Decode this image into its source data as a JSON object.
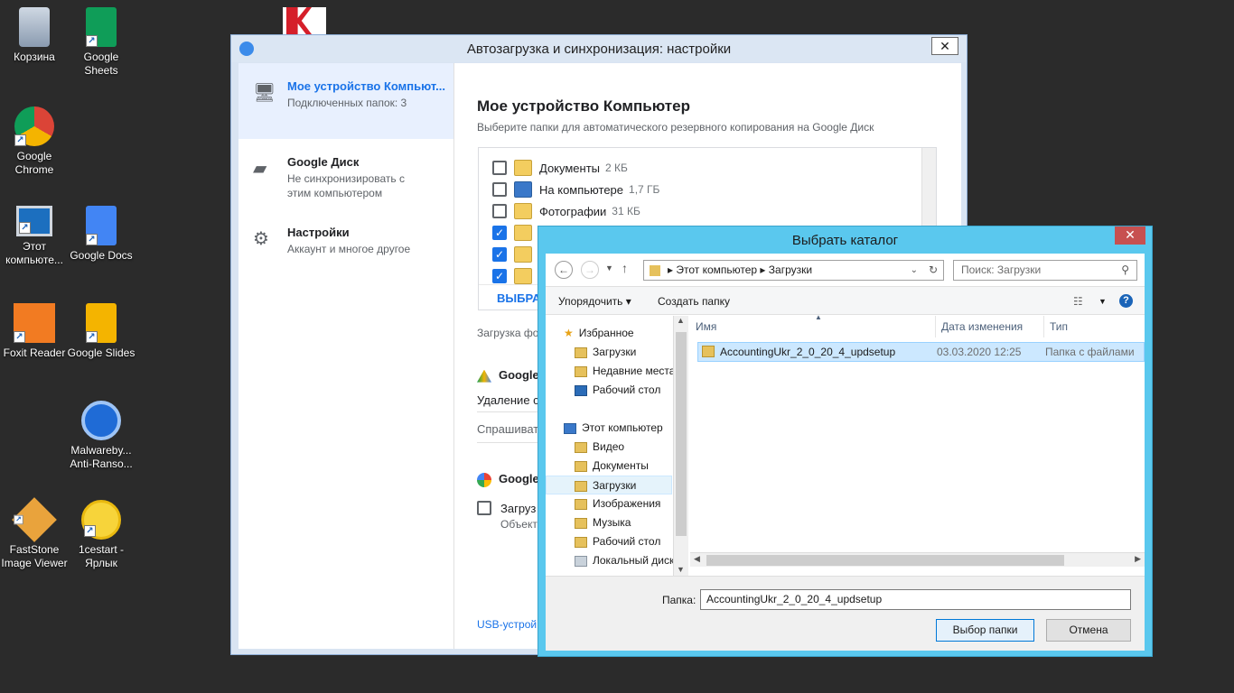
{
  "desktop": {
    "icons": [
      {
        "label": "Корзина"
      },
      {
        "label": "Google Sheets"
      },
      {
        "label": "Google Chrome"
      },
      {
        "label": "Этот компьюте..."
      },
      {
        "label": "Google Docs"
      },
      {
        "label": "Foxit Reader"
      },
      {
        "label": "Google Slides"
      },
      {
        "label": "Malwareby... Anti-Ranso..."
      },
      {
        "label": "FastStone Image Viewer"
      },
      {
        "label": "1cestart - Ярлык"
      }
    ]
  },
  "gdrive": {
    "window_title": "Автозагрузка и синхронизация: настройки",
    "close": "✕",
    "sidebar": [
      {
        "title": "Мое устройство Компьют...",
        "sub": "Подключенных папок: 3"
      },
      {
        "title": "Google Диск",
        "sub": "Не синхронизировать с этим компьютером"
      },
      {
        "title": "Настройки",
        "sub": "Аккаунт и многое другое"
      }
    ],
    "heading": "Мое устройство Компьютер",
    "subheading": "Выберите папки для автоматического резервного копирования на Google Диск",
    "folders": [
      {
        "name": "Документы",
        "size": "2 КБ",
        "checked": false
      },
      {
        "name": "На компьютере",
        "size": "1,7 ГБ",
        "checked": false
      },
      {
        "name": "Фотографии",
        "size": "31 КБ",
        "checked": false
      }
    ],
    "select_link": "ВЫБРАТ",
    "upload_text": "Загрузка фо",
    "google_drive_label": "Google",
    "delete_label": "Удаление с",
    "ask_label": "Спрашиват",
    "google_photos_label": "Google",
    "upload_checkbox_label": "Загруз",
    "objects_label": "Объекты",
    "usb_link": "USB-устрой"
  },
  "dialog": {
    "title": "Выбрать каталог",
    "close": "✕",
    "address": "Этот компьютер  ▸  Загрузки",
    "search_placeholder": "Поиск: Загрузки",
    "organize": "Упорядочить ▾",
    "new_folder": "Создать папку",
    "nav": {
      "favorites": "Избранное",
      "downloads": "Загрузки",
      "recent": "Недавние места",
      "desktop": "Рабочий стол",
      "this_pc": "Этот компьютер",
      "video": "Видео",
      "documents": "Документы",
      "downloads2": "Загрузки",
      "pictures": "Изображения",
      "music": "Музыка",
      "desktop2": "Рабочий стол",
      "local_disk": "Локальный диск"
    },
    "columns": {
      "name": "Имя",
      "date": "Дата изменения",
      "type": "Тип"
    },
    "files": [
      {
        "name": "AccountingUkr_2_0_20_4_updsetup",
        "date": "03.03.2020 12:25",
        "type": "Папка с файлами"
      }
    ],
    "folder_label": "Папка:",
    "folder_value": "AccountingUkr_2_0_20_4_updsetup",
    "select_button": "Выбор папки",
    "cancel_button": "Отмена"
  }
}
